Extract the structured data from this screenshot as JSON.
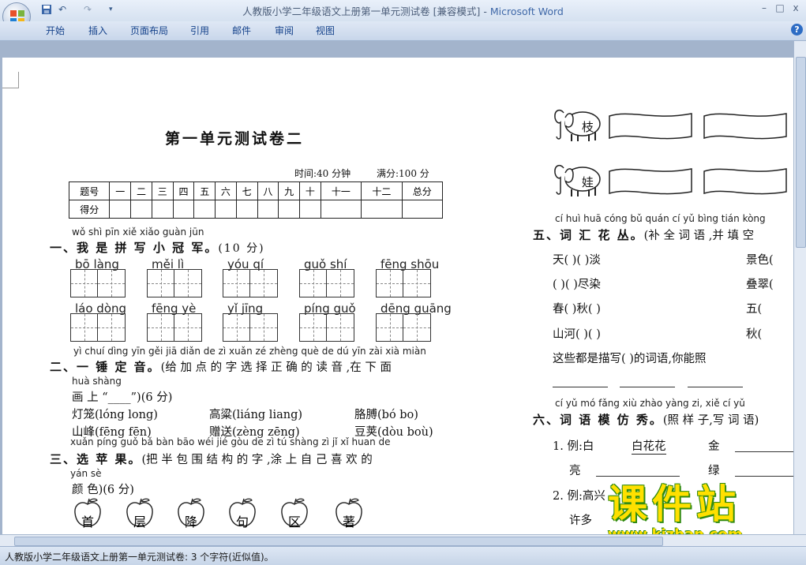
{
  "window": {
    "title_doc": "人教版小学二年级语文上册第一单元测试卷 [兼容模式] - ",
    "title_app": "Microsoft Word",
    "minimize": "–",
    "maximize": "□",
    "close": "x"
  },
  "qat": {
    "save_icon": "save-icon",
    "undo": "↶",
    "redo": "↷",
    "customize": "▾"
  },
  "ribbon": {
    "tabs": [
      "开始",
      "插入",
      "页面布局",
      "引用",
      "邮件",
      "审阅",
      "视图"
    ],
    "help": "?"
  },
  "status": {
    "text": "人教版小学二年级语文上册第一单元测试卷: 3 个字符(近似值)。"
  },
  "doc": {
    "title": "第一单元测试卷二",
    "time": "时间:40 分钟",
    "score_total": "满分:100 分",
    "score_table": {
      "header": [
        "题号",
        "一",
        "二",
        "三",
        "四",
        "五",
        "六",
        "七",
        "八",
        "九",
        "十",
        "十一",
        "十二",
        "总分"
      ],
      "row2_label": "得分"
    },
    "q1": {
      "pinyin": "wǒ shì pīn xiě xiǎo guàn jūn",
      "title": "一、我 是 拼 写 小  冠  军。",
      "points": "(10 分)",
      "row1": [
        "bō làng",
        "měi lì",
        "yóu qí",
        "guǒ shí",
        "fēng shōu"
      ],
      "row2": [
        "láo dòng",
        "fēng yè",
        "yǐ jīng",
        "píng guǒ",
        "dēng guāng"
      ]
    },
    "q2": {
      "pinyin": "yì chuí dìng yīn      gěi jiā diǎn de zì xuǎn zé zhèng què de dú yīn zài xià miàn",
      "title": "二、一  锤  定  音。",
      "instr": "(给 加 点 的 字 选 择  正   确 的 读 音 ,在 下  面",
      "pinyin2": "huà shàng",
      "line2": "画   上 “____”)(6 分)",
      "items": [
        "灯笼(lóng    long)",
        "高粱(liáng    liang)",
        "胳膊(bó    bo)",
        "山峰(fēng    fēn)",
        "赠送(zèng    zēng)",
        "豆荚(dòu    boù)"
      ]
    },
    "q3": {
      "pinyin": "xuǎn píng guǒ     bǎ bàn bāo wéi jié gòu de zì   tú shàng zì  jǐ   xǐ  huan de",
      "title": "三、选   苹   果。",
      "instr": "(把 半 包 围 结 构 的 字 ,涂   上   自 己 喜  欢   的",
      "pinyin2": "yán sè",
      "line2": "颜 色)(6 分)",
      "apples": [
        "首",
        "层",
        "降",
        "句",
        "区",
        "著"
      ]
    },
    "right": {
      "elephants": [
        "枝",
        "娃"
      ],
      "q5_pinyin": "cí huì huā cóng      bǔ quán cí  yǔ   bìng tián kòng",
      "q5_title": "五、词 汇  花  丛。",
      "q5_instr": "(补  全  词 语 ,并  填   空",
      "q5_rows": [
        [
          "天(        )(          )淡",
          "景色("
        ],
        [
          "(        )(          )尽染",
          "叠翠("
        ],
        [
          "春(        )秋(          )",
          "五("
        ],
        [
          "山河(        )(          )",
          "秋("
        ]
      ],
      "q5_summary": "这些都是描写(              )的词语,你能照",
      "q6_pinyin": "cí  yǔ mó fǎng xiù       zhào yàng zi, xiě cí  yǔ",
      "q6_title": "六、词 语 模 仿  秀。",
      "q6_instr": "(照    样   子,写 词 语)",
      "q6_ex1_label": "1. 例:白",
      "q6_ex1_answer": "白花花",
      "q6_ex1_next": "金",
      "q6_row2_a": "亮",
      "q6_row2_b": "绿",
      "q6_ex2_label": "2. 例:高兴",
      "q6_row4": "许多"
    }
  },
  "watermark": {
    "cn": "课件站",
    "url": "www.kjzhan.com"
  }
}
